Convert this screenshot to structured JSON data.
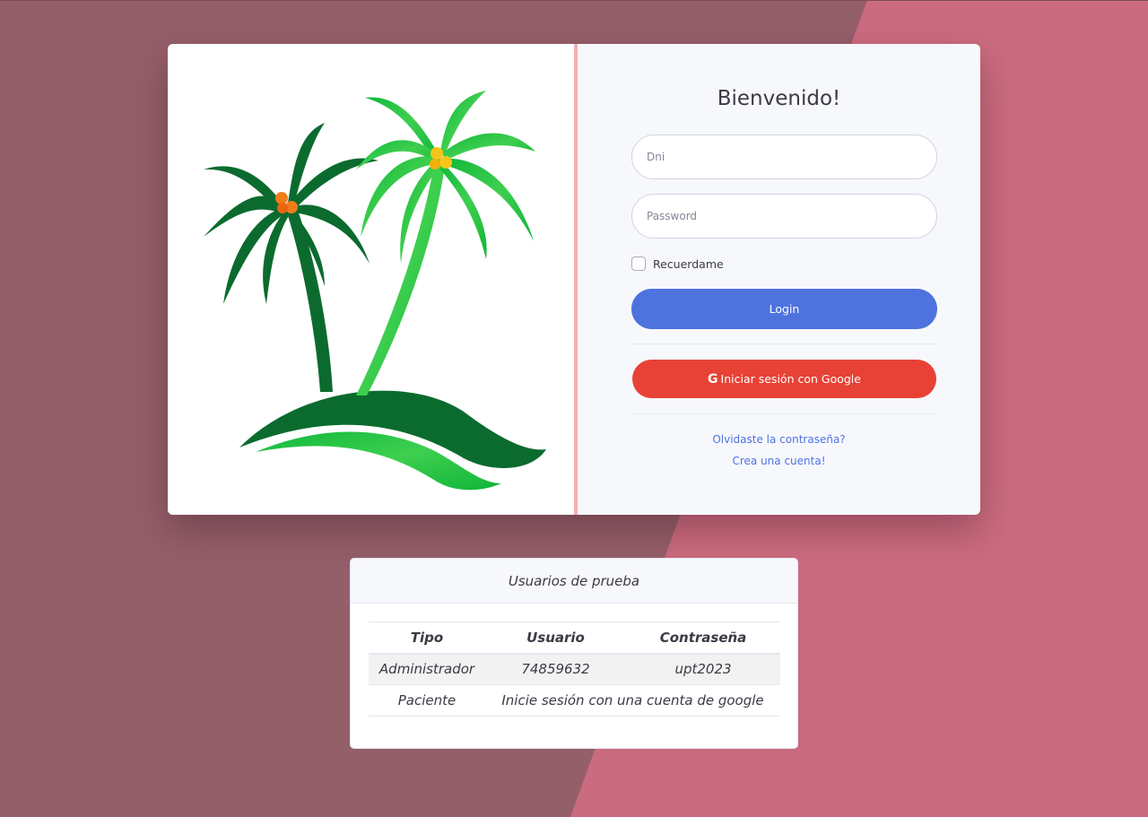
{
  "login": {
    "title": "Bienvenido!",
    "dni_placeholder": "Dni",
    "password_placeholder": "Password",
    "remember_label": "Recuerdame",
    "remember_checked": false,
    "login_button": "Login",
    "google_icon": "G",
    "google_button": "Iniciar sesión con Google",
    "forgot_link": "Olvidaste la contraseña?",
    "create_link": "Crea una cuenta!"
  },
  "test_users": {
    "title": "Usuarios de prueba",
    "headers": [
      "Tipo",
      "Usuario",
      "Contraseña"
    ],
    "rows": [
      {
        "tipo": "Administrador",
        "usuario": "74859632",
        "contrasena": "upt2023"
      },
      {
        "tipo": "Paciente",
        "merged": "Inicie sesión con una cuenta de google"
      }
    ]
  },
  "colors": {
    "background_dark": "#955f6a",
    "background_light": "#cb6b7f",
    "login_button": "#4e73df",
    "google_button": "#e74235",
    "link": "#4e73df"
  },
  "icons": {
    "logo": "palm-trees-logo",
    "google": "google-icon"
  }
}
